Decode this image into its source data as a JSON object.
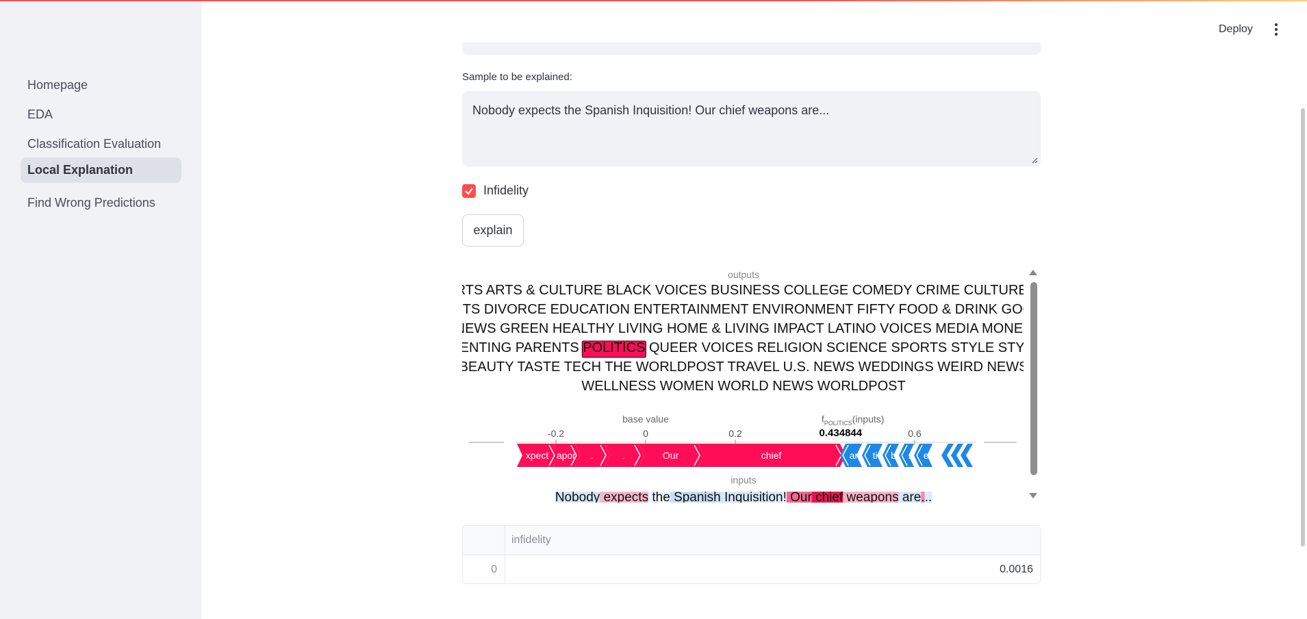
{
  "header": {
    "deploy_label": "Deploy"
  },
  "sidebar": {
    "items": [
      {
        "label": "Homepage",
        "active": false
      },
      {
        "label": "EDA",
        "active": false
      },
      {
        "label": "Classification Evaluation",
        "active": false
      },
      {
        "label": "Local Explanation",
        "active": true
      },
      {
        "label": "Find Wrong Predictions",
        "active": false
      }
    ]
  },
  "main": {
    "sample_label": "Sample to be explained:",
    "sample_value": "Nobody expects the Spanish Inquisition! Our chief weapons are...",
    "checkbox_label": "Infidelity",
    "checkbox_checked": true,
    "explain_button": "explain"
  },
  "shap": {
    "outputs_label": "outputs",
    "output_lines": [
      [
        {
          "t": "ARTS ARTS & CULTURE BLACK VOICES BUSINESS COLLEGE COMEDY CRIME CULTURE &"
        }
      ],
      [
        {
          "t": "ARTS DIVORCE EDUCATION ENTERTAINMENT ENVIRONMENT FIFTY FOOD & DRINK GOOD"
        }
      ],
      [
        {
          "t": "NEWS GREEN HEALTHY LIVING HOME & LIVING IMPACT LATINO VOICES MEDIA MONEY"
        }
      ],
      [
        {
          "t": "PARENTING PARENTS "
        },
        {
          "t": "POLITICS",
          "hl": true
        },
        {
          "t": " QUEER VOICES RELIGION SCIENCE SPORTS STYLE STYLE &"
        }
      ],
      [
        {
          "t": "BEAUTY TASTE TECH THE WORLDPOST TRAVEL U.S. NEWS WEDDINGS WEIRD NEWS"
        }
      ],
      [
        {
          "t": "WELLNESS WOMEN WORLD NEWS WORLDPOST"
        }
      ]
    ],
    "base_value_label": "base value",
    "f_label_prefix": "f",
    "f_label_sub": "POLITICS",
    "f_label_suffix": "(inputs)",
    "f_value": "0.434844",
    "ticks": [
      "-0.2",
      "0",
      "0.2",
      "0.6"
    ],
    "pos_segments": [
      "xpect",
      "apor",
      ".",
      ".",
      "Our",
      "chief"
    ],
    "neg_segments": [
      "ar",
      "ti",
      "b",
      ".",
      "e"
    ],
    "inputs_label": "inputs",
    "input_tokens": [
      {
        "t": "Nobody",
        "c": "#d4e6f9"
      },
      {
        "t": " expects",
        "c": "#f6b5c8"
      },
      {
        "t": " the",
        "c": "#eaf3fc"
      },
      {
        "t": " Spanish",
        "c": "#c7def7"
      },
      {
        "t": " Inquisition",
        "c": "#d7e8fa"
      },
      {
        "t": "!",
        "c": "#eef5fd"
      },
      {
        "t": " Our",
        "c": "#f3668f"
      },
      {
        "t": " chief",
        "c": "#e8144f"
      },
      {
        "t": " weapons",
        "c": "#f7b3c7"
      },
      {
        "t": " are",
        "c": "#d6e7fa"
      },
      {
        "t": ".",
        "c": "#f48aaa"
      },
      {
        "t": "..",
        "c": "#dceafb"
      }
    ],
    "colors": {
      "positive": "#ff0d57",
      "negative": "#1e88e5"
    }
  },
  "table": {
    "column": "infidelity",
    "rows": [
      {
        "index": "0",
        "value": "0.0016"
      }
    ]
  }
}
